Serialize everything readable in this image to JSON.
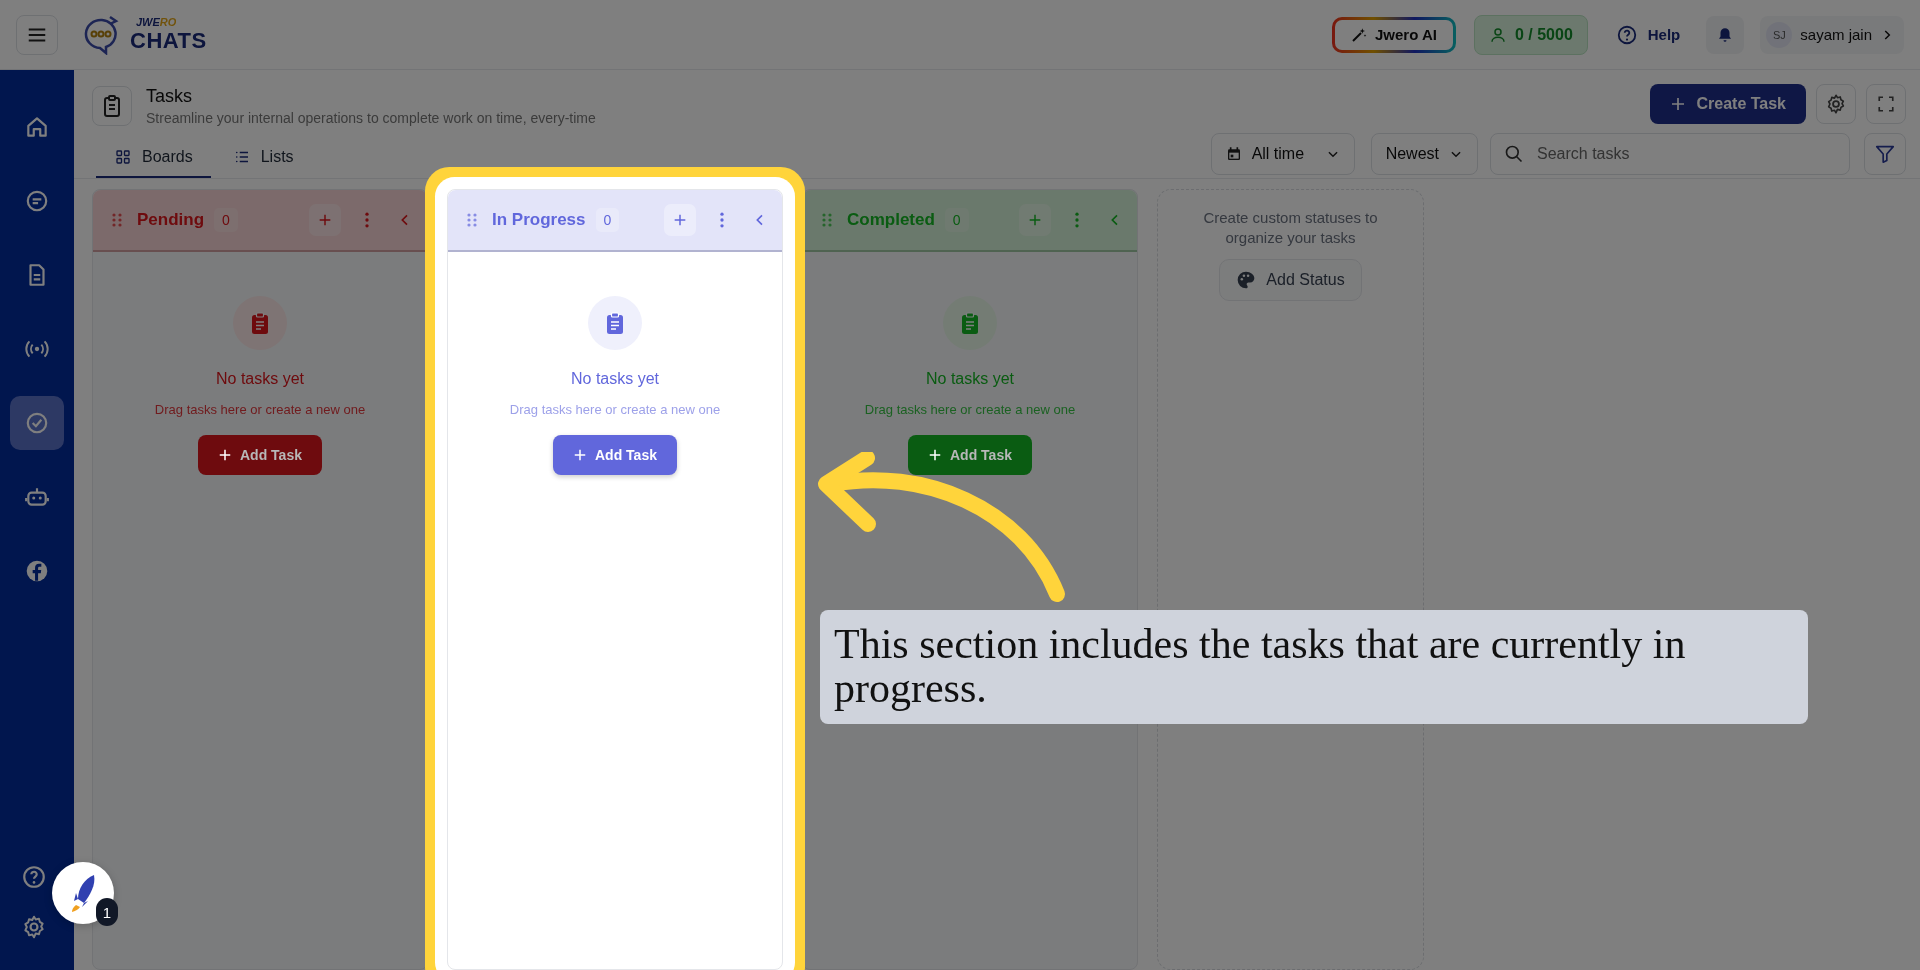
{
  "top_bar": {
    "logo": {
      "small": "JWERO",
      "big": "CHATS"
    },
    "ai_button": "Jwero AI",
    "contacts": "0 / 5000",
    "help": "Help",
    "user": {
      "initials": "SJ",
      "name": "sayam jain"
    }
  },
  "sidebar": {
    "items": [
      {
        "kind": "home",
        "selected": false
      },
      {
        "kind": "chat",
        "selected": false
      },
      {
        "kind": "document",
        "selected": false
      },
      {
        "kind": "broadcast",
        "selected": false
      },
      {
        "kind": "tasks",
        "selected": true
      },
      {
        "kind": "bot",
        "selected": false
      },
      {
        "kind": "facebook",
        "selected": false
      }
    ],
    "bottom": [
      {
        "kind": "help"
      },
      {
        "kind": "settings"
      }
    ]
  },
  "launcher": {
    "badge": "1"
  },
  "page": {
    "title": "Tasks",
    "subtitle": "Streamline your internal operations to complete work on time, every-time"
  },
  "view_tabs": [
    {
      "label": "Boards",
      "kind": "grid",
      "selected": true
    },
    {
      "label": "Lists",
      "kind": "list",
      "selected": false
    }
  ],
  "create_button": "Create Task",
  "filters": {
    "date": "All time",
    "sort": "Newest",
    "search_placeholder": "Search tasks"
  },
  "columns": [
    {
      "name": "Pending",
      "count": "0",
      "color": "#6e0b0e",
      "empty_title": "No tasks yet",
      "empty_hint": "Drag tasks here or create a new one",
      "add_button": "Add Task",
      "highlighted": false
    },
    {
      "name": "In Progress",
      "count": "0",
      "color": "#6167dc",
      "empty_title": "No tasks yet",
      "empty_hint": "Drag tasks here or create a new one",
      "add_button": "Add Task",
      "highlighted": true
    },
    {
      "name": "Completed",
      "count": "0",
      "color": "#0a5c12",
      "empty_title": "No tasks yet",
      "empty_hint": "Drag tasks here or create a new one",
      "add_button": "Add Task",
      "highlighted": false
    }
  ],
  "add_status": {
    "hint": "Create custom statuses to organize your tasks",
    "button": "Add Status"
  },
  "tutorial": {
    "callout": "This section includes the tasks that are currently in progress."
  }
}
